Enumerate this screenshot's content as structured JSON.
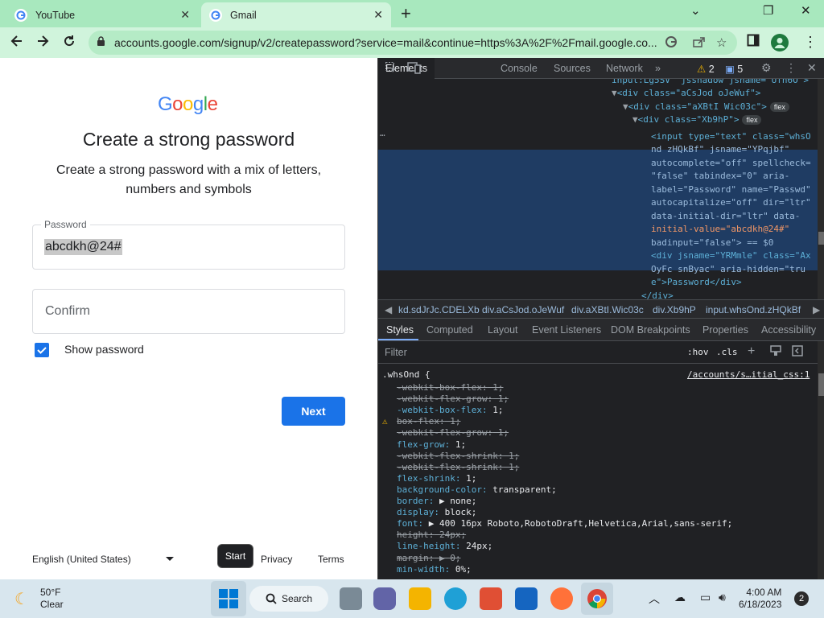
{
  "browser": {
    "tabs": [
      {
        "title": "YouTube",
        "close": "✕"
      },
      {
        "title": "Gmail",
        "close": "✕"
      }
    ],
    "new_tab": "+",
    "window_controls": {
      "minimize": "⌄",
      "restore": "❐",
      "close": "✕"
    },
    "url": "accounts.google.com/signup/v2/createpassword?service=mail&continue=https%3A%2F%2Fmail.google.co..."
  },
  "page": {
    "logo": "Google",
    "title": "Create a strong password",
    "subtitle": "Create a strong password with a mix of letters, numbers and symbols",
    "password_label": "Password",
    "password_value": "abcdkh@24#",
    "confirm_placeholder": "Confirm",
    "show_password_label": "Show password",
    "show_password_checked": true,
    "next_label": "Next",
    "language": "English (United States)",
    "footer": {
      "help": "Start",
      "privacy": "Privacy",
      "terms": "Terms"
    },
    "tooltip": "Start"
  },
  "devtools": {
    "tabs": [
      "Elements",
      "Console",
      "Sources",
      "Network"
    ],
    "more_tabs": "»",
    "warnings": "2",
    "messages": "5",
    "dom_lines": [
      "input:Lg5SV\" jsshadow jsname=\"Ufn6O\">",
      "<div class=\"aCsJod oJeWuf\">",
      "<div class=\"aXBtI Wic03c\">",
      "<div class=\"Xb9hP\">",
      "<input type=\"text\" class=\"whsO",
      "nd zHQkBf\" jsname=\"YPqjbf\"",
      "autocomplete=\"off\" spellcheck=",
      "\"false\" tabindex=\"0\" aria-",
      "label=\"Password\" name=\"Passwd\"",
      "autocapitalize=\"off\" dir=\"ltr\"",
      "data-initial-dir=\"ltr\" data-",
      "initial-value=\"abcdkh@24#\"",
      "badinput=\"false\"> == $0",
      "<div jsname=\"YRMmle\" class=\"Ax",
      "OyFc snByac\" aria-hidden=\"tru",
      "e\">Password</div>",
      "</div>"
    ],
    "flex_badge": "flex",
    "ellipsis": "…",
    "breadcrumbs": [
      "kd.sdJrJc.CDELXb",
      "div.aCsJod.oJeWuf",
      "div.aXBtI.Wic03c",
      "div.Xb9hP",
      "input.whsOnd.zHQkBf"
    ],
    "style_tabs": [
      "Styles",
      "Computed",
      "Layout",
      "Event Listeners",
      "DOM Breakpoints",
      "Properties",
      "Accessibility"
    ],
    "filter_placeholder": "Filter",
    "hov": ":hov",
    "cls": ".cls",
    "selector": ".whsOnd {",
    "source_link": "/accounts/s…itial_css:1",
    "rules": [
      {
        "text": "-webkit-box-flex: 1;",
        "struck": true
      },
      {
        "text": "-webkit-flex-grow: 1;",
        "struck": true
      },
      {
        "text": "-webkit-box-flex: 1;",
        "struck": false
      },
      {
        "text": "box-flex: 1;",
        "struck": true,
        "warn": true
      },
      {
        "text": "-webkit-flex-grow: 1;",
        "struck": true
      },
      {
        "text": "flex-grow: 1;",
        "struck": false
      },
      {
        "text": "-webkit-flex-shrink: 1;",
        "struck": true
      },
      {
        "text": "-webkit-flex-shrink: 1;",
        "struck": true
      },
      {
        "text": "flex-shrink: 1;",
        "struck": false
      },
      {
        "text": "background-color: transparent;",
        "struck": false
      },
      {
        "text": "border: ▶ none;",
        "struck": false
      },
      {
        "text": "display: block;",
        "struck": false
      },
      {
        "text": "font: ▶ 400 16px Roboto,RobotoDraft,Helvetica,Arial,sans-serif;",
        "struck": false
      },
      {
        "text": "height: 24px;",
        "struck": true
      },
      {
        "text": "line-height: 24px;",
        "struck": false
      },
      {
        "text": "margin: ▶ 0;",
        "struck": true
      },
      {
        "text": "min-width: 0%;",
        "struck": false
      }
    ]
  },
  "taskbar": {
    "weather_temp": "50°F",
    "weather_desc": "Clear",
    "search_label": "Search",
    "time": "4:00 AM",
    "date": "6/18/2023",
    "notifications": "2"
  }
}
